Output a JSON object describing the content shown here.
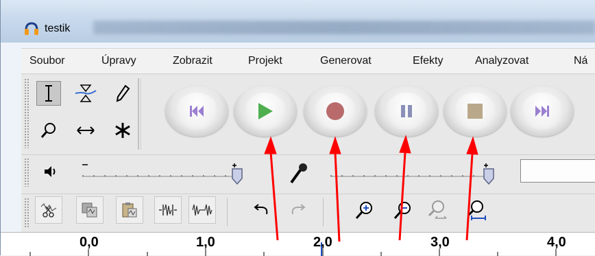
{
  "window": {
    "title": "testik"
  },
  "menu": {
    "items": [
      "Soubor",
      "Úpravy",
      "Zobrazit",
      "Projekt",
      "Generovat",
      "Efekty",
      "Analyzovat",
      "Ná"
    ]
  },
  "tools": [
    "selection-tool",
    "envelope-tool",
    "draw-tool",
    "zoom-tool",
    "time-shift-tool",
    "multi-tool"
  ],
  "transport": [
    "skip-to-start",
    "play",
    "record",
    "pause",
    "stop",
    "skip-to-end"
  ],
  "colors": {
    "play": "#4fae4f",
    "record": "#b96b6b",
    "pause": "#8a90b8",
    "stop": "#b9a98a",
    "skip": "#9b7fd1",
    "arrow": "#ff0000"
  },
  "ruler": {
    "labels": [
      "0,0",
      "1,0",
      "2,0",
      "3,0",
      "4,0"
    ]
  }
}
